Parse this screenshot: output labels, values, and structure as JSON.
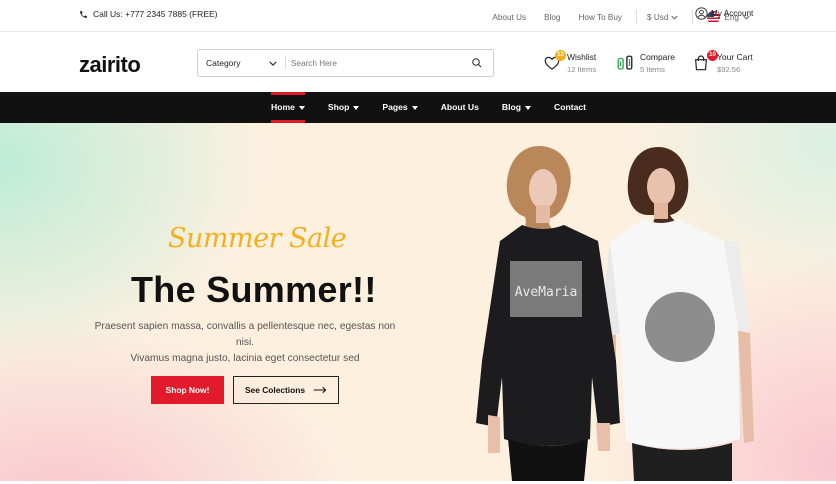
{
  "topbar": {
    "call": "Call Us: +777 2345 7885 (FREE)",
    "links": [
      "About Us",
      "Blog",
      "How To Buy"
    ],
    "currency": "$ Usd",
    "language": "Eng",
    "account": "My Account"
  },
  "header": {
    "logo": "zairito",
    "search": {
      "category": "Category",
      "placeholder": "Search Here"
    },
    "wishlist": {
      "label": "Wishlist",
      "sub": "12 Items",
      "badge": "12"
    },
    "compare": {
      "label": "Compare",
      "sub": "5 Items"
    },
    "cart": {
      "label": "Your Cart",
      "sub": "$92.56",
      "badge": "10"
    }
  },
  "nav": {
    "items": [
      {
        "label": "Home",
        "dropdown": true,
        "active": true
      },
      {
        "label": "Shop",
        "dropdown": true
      },
      {
        "label": "Pages",
        "dropdown": true
      },
      {
        "label": "About Us",
        "dropdown": false
      },
      {
        "label": "Blog",
        "dropdown": true
      },
      {
        "label": "Contact",
        "dropdown": false
      }
    ]
  },
  "hero": {
    "script_title": "Summer Sale",
    "title": "The Summer!!",
    "description_line1": "Praesent sapien massa, convallis a pellentesque nec, egestas non nisi.",
    "description_line2": "Vivamus magna justo, lacinia eget consectetur sed",
    "primary_button": "Shop Now!",
    "secondary_button": "See Colections",
    "shirt_print": "AveMaria"
  },
  "colors": {
    "accent": "#e21b2c",
    "nav_bg": "#111111",
    "script_yellow": "#f2b01e",
    "wishlist_badge": "#f2b01e",
    "compare_green": "#2fa84f"
  }
}
